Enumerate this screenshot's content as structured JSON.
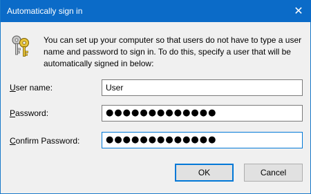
{
  "window": {
    "title": "Automatically sign in",
    "close_glyph": "✕"
  },
  "description": "You can set up your computer so that users do not have to type a user name and password to sign in. To do this, specify a user that will be automatically signed in below:",
  "fields": {
    "username": {
      "label_first": "U",
      "label_rest": "ser name:",
      "value": "User"
    },
    "password": {
      "label_first": "P",
      "label_rest": "assword:",
      "value": "●●●●●●●●●●●●●"
    },
    "confirm": {
      "label_first": "C",
      "label_rest": "onfirm Password:",
      "value": "●●●●●●●●●●●●●"
    }
  },
  "buttons": {
    "ok": "OK",
    "cancel": "Cancel"
  },
  "colors": {
    "titlebar": "#0b6bc8",
    "focus_border": "#0078d7"
  },
  "icons": {
    "header": "keys-icon",
    "close": "close-icon"
  }
}
